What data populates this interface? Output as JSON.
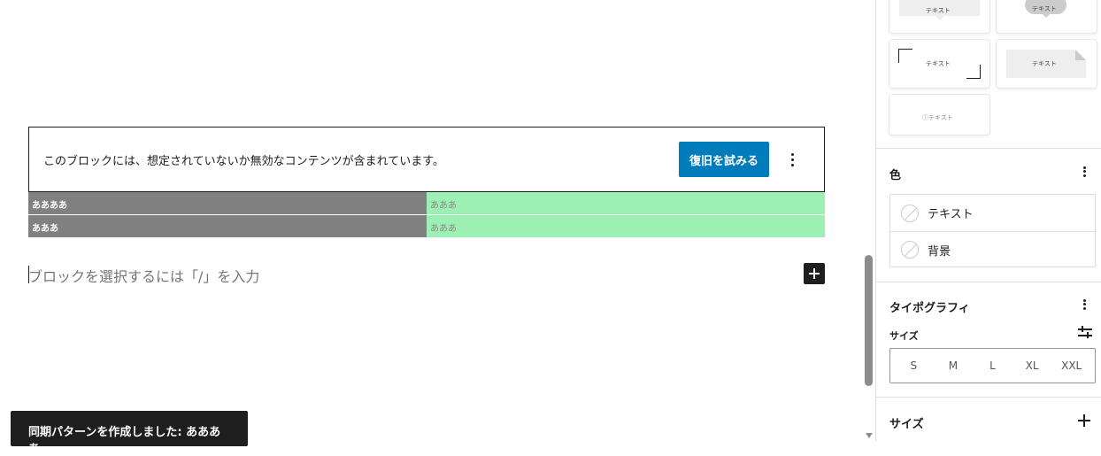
{
  "editor": {
    "warning": {
      "message": "このブロックには、想定されていないか無効なコンテンツが含まれています。",
      "recover_label": "復旧を試みる"
    },
    "table_rows": [
      {
        "head": "ああああ",
        "value": "あああ"
      },
      {
        "head": "あああ",
        "value": "あああ"
      }
    ],
    "placeholder": "ブロックを選択するには「/」を入力",
    "snackbar": "同期パターンを作成しました: ああああ"
  },
  "sidebar": {
    "styles": [
      {
        "label": "テキスト"
      },
      {
        "label": "テキスト"
      },
      {
        "label": "テキスト"
      },
      {
        "label": "テキスト"
      },
      {
        "label": "ⓘテキスト"
      }
    ],
    "color_panel": {
      "title": "色",
      "items": [
        {
          "label": "テキスト"
        },
        {
          "label": "背景"
        }
      ]
    },
    "typography_panel": {
      "title": "タイポグラフィ",
      "size_label": "サイズ",
      "sizes": [
        "S",
        "M",
        "L",
        "XL",
        "XXL"
      ]
    },
    "size_panel": {
      "title": "サイズ"
    }
  },
  "colors": {
    "primary": "#007cba",
    "table_head_bg": "#808080",
    "table_value_bg": "#9cf0b3",
    "snackbar_bg": "#1e1e1e"
  }
}
